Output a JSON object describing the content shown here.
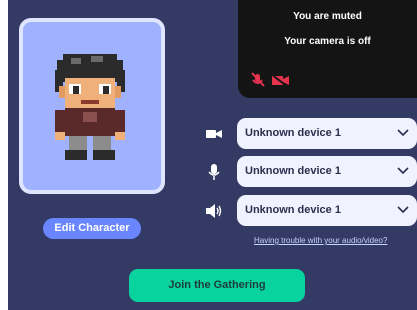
{
  "avatar": {
    "edit_label": "Edit Character"
  },
  "video": {
    "muted_text": "You are muted",
    "camera_text": "Your camera is off",
    "icon_names": [
      "mic-muted-icon",
      "camera-off-icon"
    ],
    "icon_color": "#e5324e"
  },
  "devices": [
    {
      "icon": "camera-icon",
      "value": "Unknown device 1"
    },
    {
      "icon": "microphone-icon",
      "value": "Unknown device 1"
    },
    {
      "icon": "speaker-icon",
      "value": "Unknown device 1"
    }
  ],
  "trouble_link": "Having trouble with your audio/video?",
  "join_label": "Join the Gathering",
  "colors": {
    "panel_bg": "#333a64",
    "avatar_bg": "#9fb1ff",
    "edit_button": "#6a86ff",
    "join_button": "#08d39f"
  }
}
